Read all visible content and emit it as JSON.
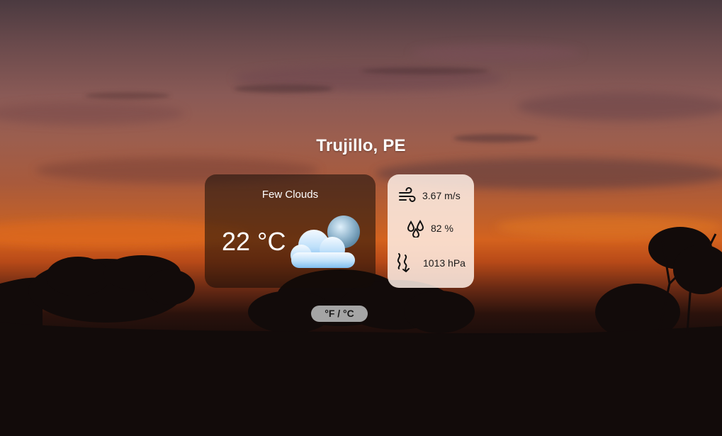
{
  "location": {
    "city": "Trujillo, PE"
  },
  "current": {
    "condition": "Few Clouds",
    "temperature": "22 °C",
    "icon": "few-clouds-icon"
  },
  "details": {
    "wind": "3.67 m/s",
    "humidity": "82 %",
    "pressure": "1013 hPa"
  },
  "controls": {
    "unit_toggle_label": "°F / °C"
  },
  "colors": {
    "main_card_bg": "#1a0f0a",
    "detail_card_bg": "#fff0e6",
    "toggle_bg": "#a5a5a5"
  }
}
